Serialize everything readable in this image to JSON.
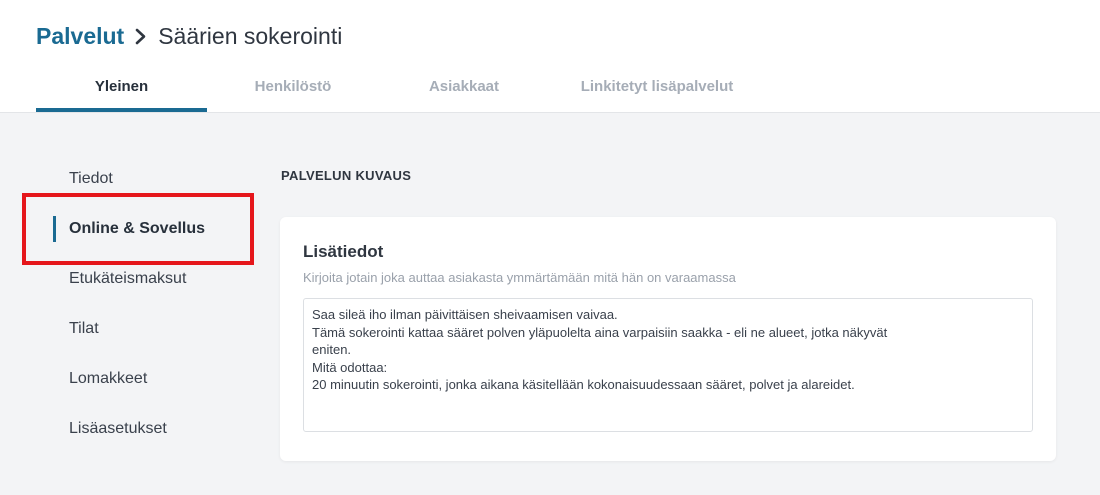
{
  "breadcrumb": {
    "parent": "Palvelut",
    "current": "Säärien sokerointi"
  },
  "tabs": [
    {
      "label": "Yleinen",
      "active": true
    },
    {
      "label": "Henkilöstö",
      "active": false
    },
    {
      "label": "Asiakkaat",
      "active": false
    },
    {
      "label": "Linkitetyt lisäpalvelut",
      "active": false
    }
  ],
  "sidebar": {
    "items": [
      {
        "label": "Tiedot",
        "active": false
      },
      {
        "label": "Online & Sovellus",
        "active": true
      },
      {
        "label": "Etukäteismaksut",
        "active": false
      },
      {
        "label": "Tilat",
        "active": false
      },
      {
        "label": "Lomakkeet",
        "active": false
      },
      {
        "label": "Lisäasetukset",
        "active": false
      }
    ]
  },
  "main": {
    "section_title": "PALVELUN KUVAUS",
    "card": {
      "title": "Lisätiedot",
      "subtitle": "Kirjoita jotain joka auttaa asiakasta ymmärtämään mitä hän on varaamassa",
      "textarea_lines": [
        "Saa sileä iho ilman päivittäisen sheivaamisen vaivaa.",
        "Tämä sokerointi kattaa sääret polven yläpuolelta aina varpaisiin saakka - eli ne alueet, jotka näkyvät",
        "eniten.",
        "Mitä odottaa:",
        "20 minuutin sokerointi, jonka aikana käsitellään kokonaisuudessaan sääret, polvet ja alareidet."
      ]
    }
  },
  "colors": {
    "accent": "#1a6a92",
    "highlight": "#e5161b",
    "background": "#f3f4f6"
  }
}
